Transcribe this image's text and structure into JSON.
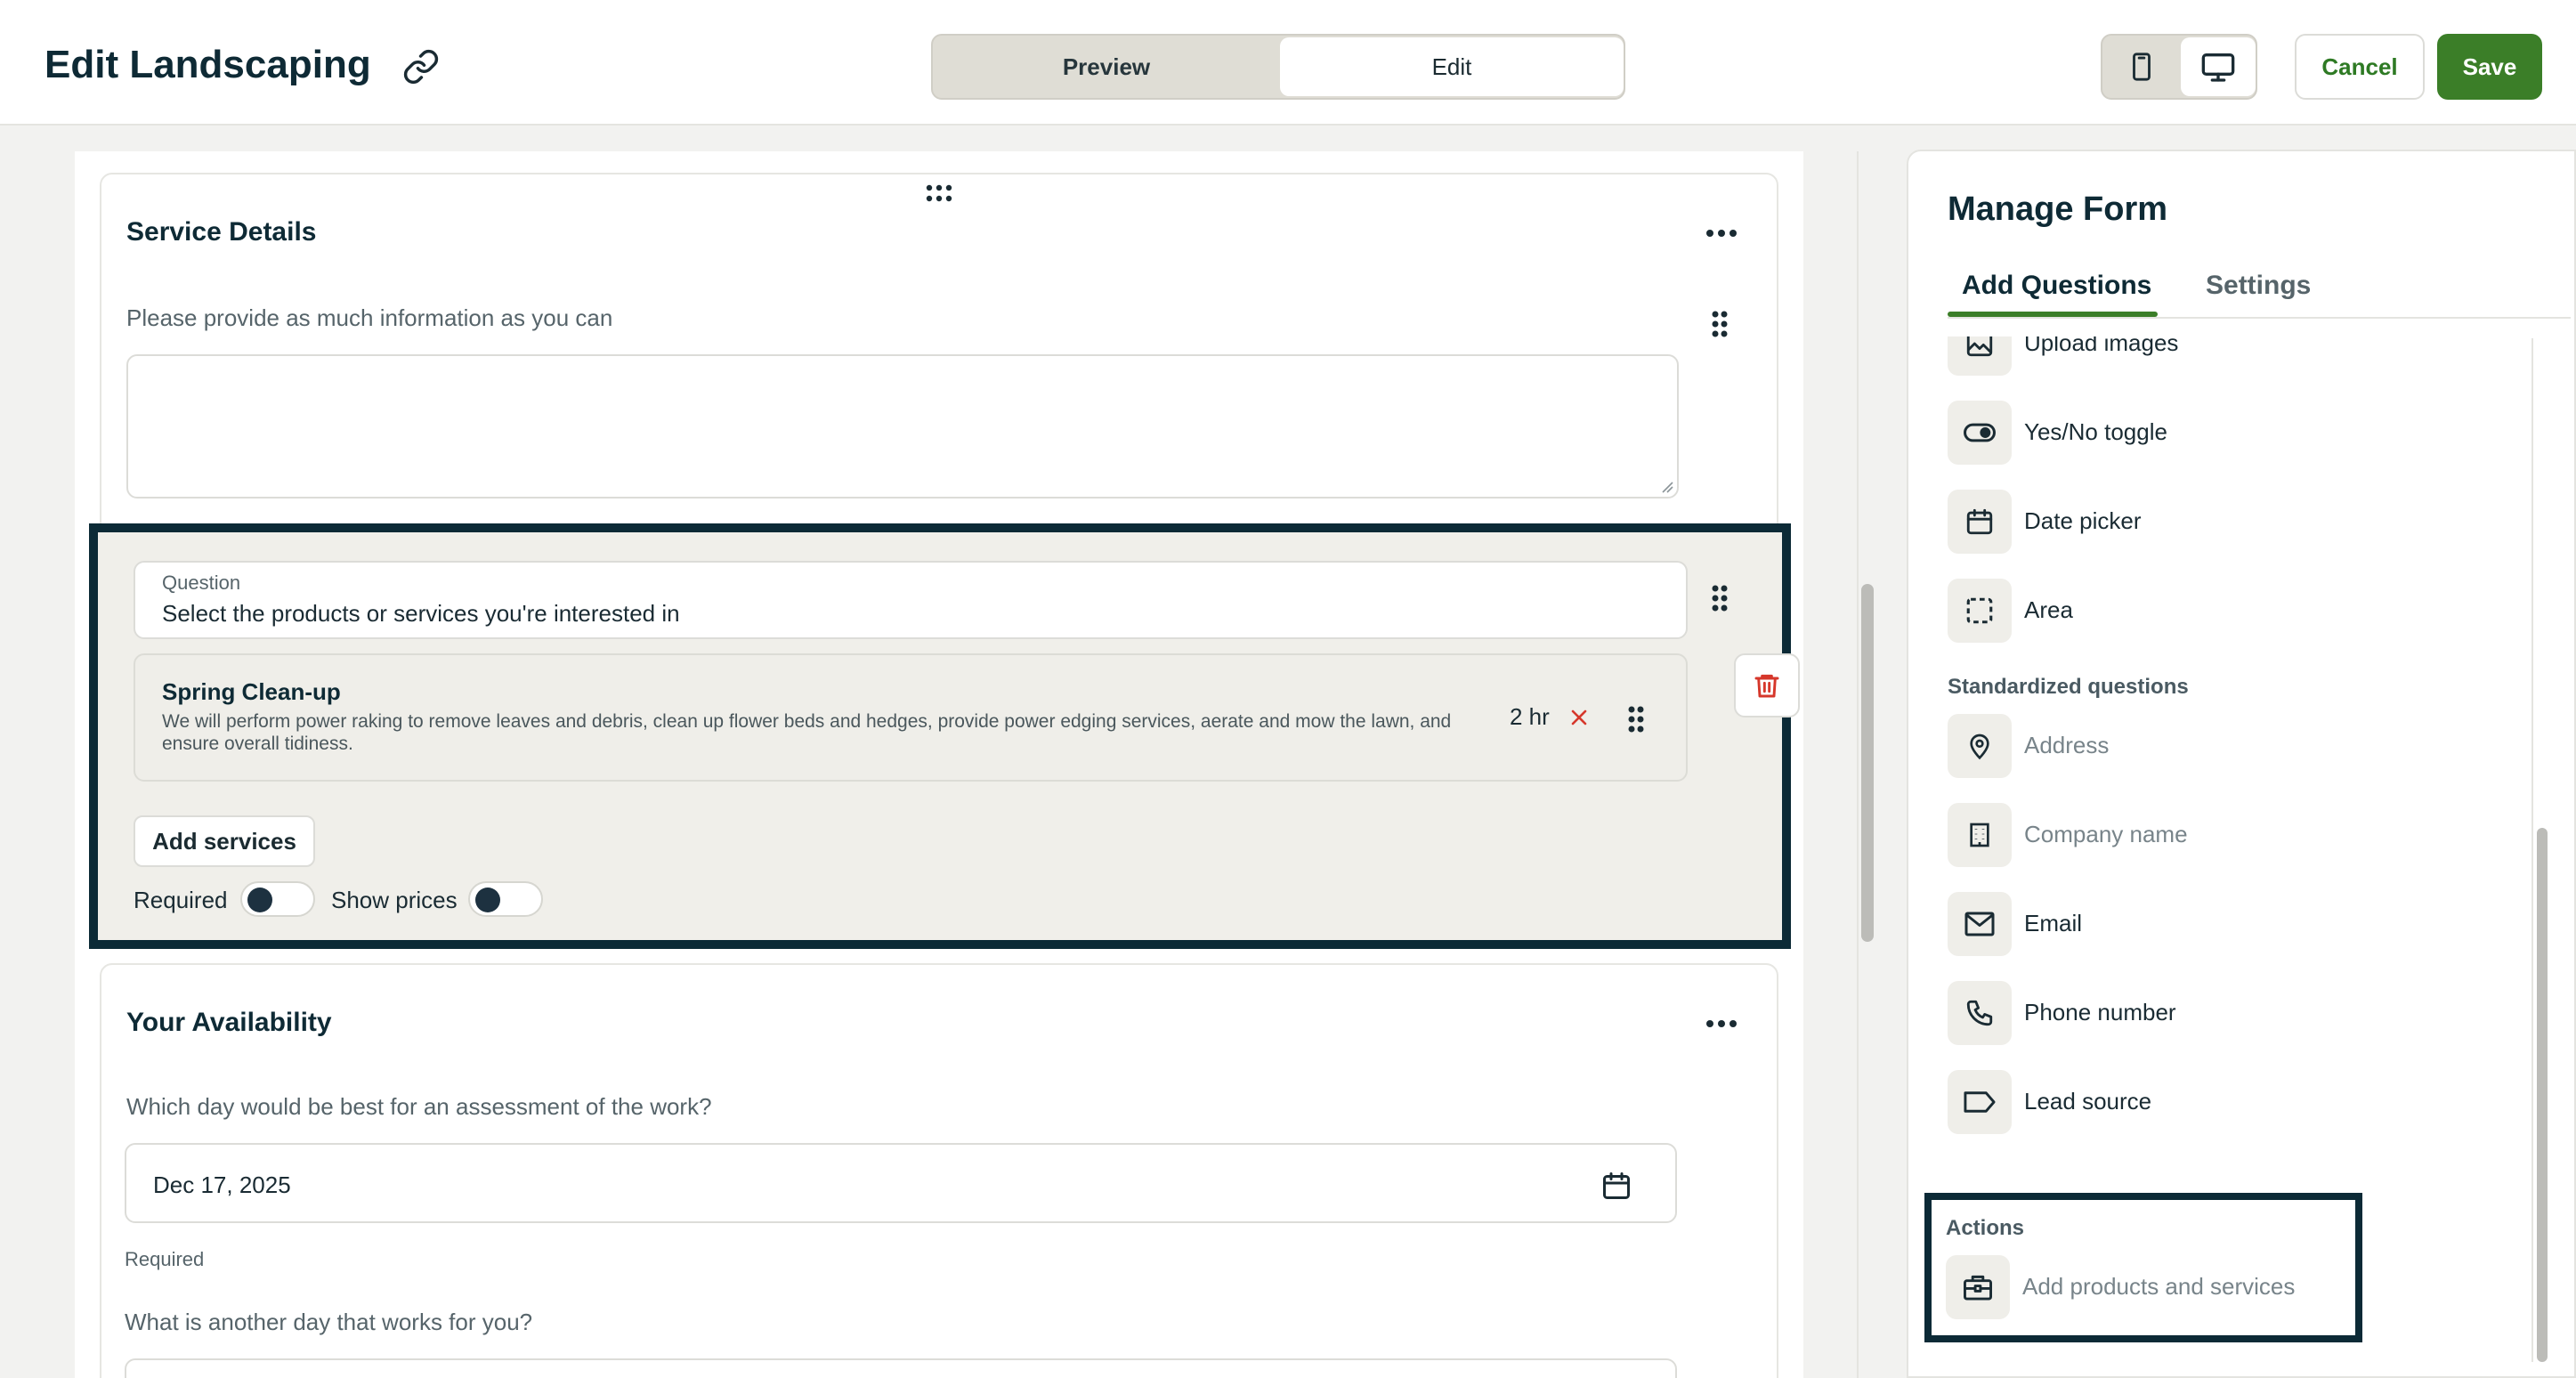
{
  "header": {
    "title": "Edit Landscaping",
    "mode_tabs": {
      "preview": "Preview",
      "edit": "Edit",
      "active": "Edit"
    },
    "cancel_label": "Cancel",
    "save_label": "Save"
  },
  "form": {
    "service_details": {
      "title": "Service Details",
      "prompt": "Please provide as much information as you can",
      "textarea_value": ""
    },
    "service_question": {
      "field_label": "Question",
      "question_text": "Select the products or services you're interested in",
      "services": [
        {
          "name": "Spring Clean-up",
          "description": "We will perform power raking to remove leaves and debris, clean up flower beds and hedges, provide power edging services, aerate and mow the lawn, and ensure overall tidiness.",
          "duration": "2 hr"
        }
      ],
      "add_services_label": "Add services",
      "required_label": "Required",
      "required_on": false,
      "show_prices_label": "Show prices",
      "show_prices_on": false
    },
    "availability": {
      "title": "Your Availability",
      "q1": "Which day would be best for an assessment of the work?",
      "q1_value": "Dec 17, 2025",
      "q1_required_note": "Required",
      "q2": "What is another day that works for you?"
    }
  },
  "panel": {
    "title": "Manage Form",
    "tabs": [
      {
        "label": "Add Questions",
        "active": true
      },
      {
        "label": "Settings",
        "active": false
      }
    ],
    "question_types": [
      {
        "label": "Upload images",
        "icon": "image-icon"
      },
      {
        "label": "Yes/No toggle",
        "icon": "toggle-icon"
      },
      {
        "label": "Date picker",
        "icon": "calendar-icon"
      },
      {
        "label": "Area",
        "icon": "dashed-square-icon"
      }
    ],
    "standardized_heading": "Standardized questions",
    "standardized": [
      {
        "label": "Address",
        "icon": "map-pin-icon",
        "disabled": true
      },
      {
        "label": "Company name",
        "icon": "building-icon",
        "disabled": true
      },
      {
        "label": "Email",
        "icon": "mail-icon",
        "disabled": false
      },
      {
        "label": "Phone number",
        "icon": "phone-icon",
        "disabled": false
      },
      {
        "label": "Lead source",
        "icon": "tag-icon",
        "disabled": false
      }
    ],
    "actions_heading": "Actions",
    "actions": [
      {
        "label": "Add products and services",
        "icon": "briefcase-icon",
        "disabled": true
      }
    ]
  },
  "colors": {
    "brand_green": "#3b7e28",
    "navy": "#0c2a36",
    "danger_red": "#d6372b",
    "panel_icon_bg": "#efeee9"
  }
}
